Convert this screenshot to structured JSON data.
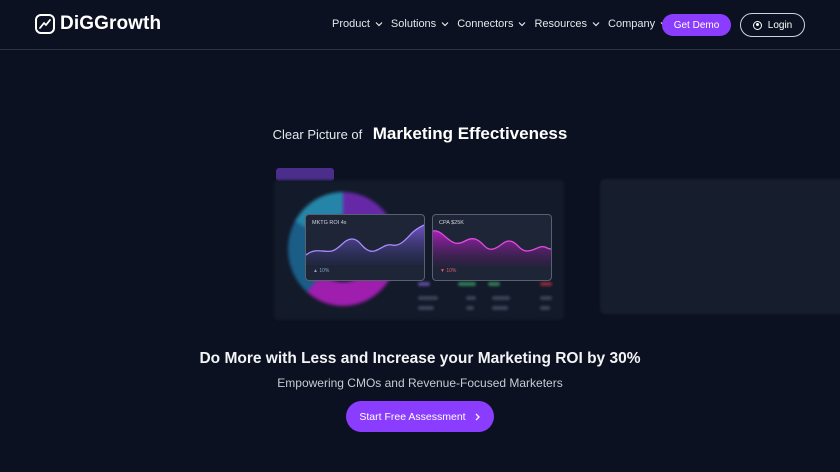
{
  "brand": {
    "name": "DiGGrowth"
  },
  "nav": {
    "items": [
      {
        "label": "Product"
      },
      {
        "label": "Solutions"
      },
      {
        "label": "Connectors"
      },
      {
        "label": "Resources"
      },
      {
        "label": "Company"
      }
    ],
    "demo_label": "Get Demo",
    "login_label": "Login"
  },
  "hero": {
    "pre_title": "Clear Picture of",
    "title": "Marketing Effectiveness",
    "tagline": "Do More with Less and Increase your Marketing ROI by 30%",
    "subtitle": "Empowering CMOs and Revenue-Focused Marketers",
    "cta_label": "Start Free Assessment"
  },
  "dashboard": {
    "card_left": {
      "title": "MKTG ROI 4x",
      "foot": "▲ 10%"
    },
    "card_right": {
      "title": "CPA $25K",
      "foot": "▼ 10%"
    }
  },
  "colors": {
    "accent": "#8b3dff",
    "background": "#0b1120"
  }
}
